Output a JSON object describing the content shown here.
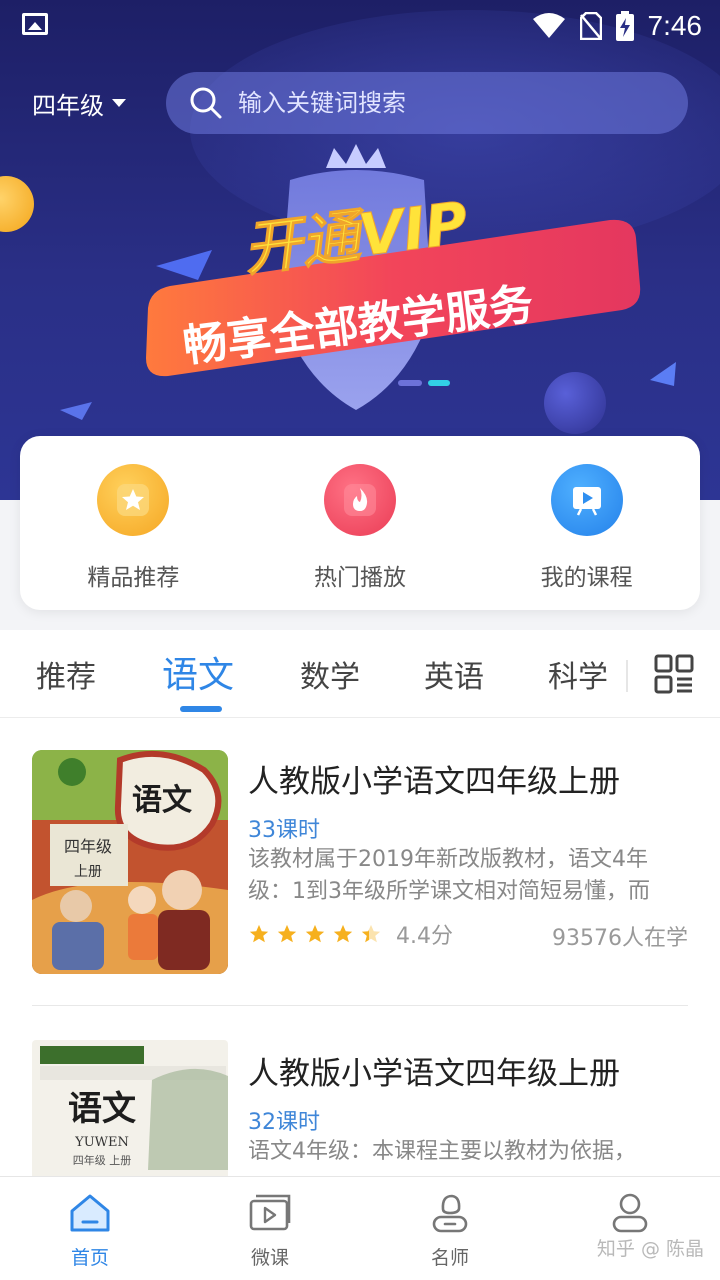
{
  "status_bar": {
    "time": "7:46"
  },
  "header": {
    "grade_label": "四年级",
    "search_placeholder": "输入关键词搜索"
  },
  "banner": {
    "line1": "开通VIP",
    "line2": "畅享全部教学服务"
  },
  "quick_actions": [
    {
      "label": "精品推荐",
      "icon": "star-icon",
      "color": "#f7b429"
    },
    {
      "label": "热门播放",
      "icon": "flame-icon",
      "color": "#f04a5c"
    },
    {
      "label": "我的课程",
      "icon": "play-board-icon",
      "color": "#2f8ff0"
    }
  ],
  "tabs": [
    {
      "label": "推荐",
      "active": false
    },
    {
      "label": "语文",
      "active": true
    },
    {
      "label": "数学",
      "active": false
    },
    {
      "label": "英语",
      "active": false
    },
    {
      "label": "科学",
      "active": false
    }
  ],
  "courses": [
    {
      "title": "人教版小学语文四年级上册",
      "lessons": "33课时",
      "description": "该教材属于2019年新改版教材，语文4年级：1到3年级所学课文相对简短易懂，而",
      "rating": 4.4,
      "rating_text": "4.4分",
      "learners": "93576人在学",
      "cover": {
        "title": "语文",
        "grade": "四年级",
        "volume": "上册"
      }
    },
    {
      "title": "人教版小学语文四年级上册",
      "lessons": "32课时",
      "description": "语文4年级：本课程主要以教材为依据，",
      "cover": {
        "title": "语文",
        "grade": "四年级 上册",
        "subtitle": "YUWEN"
      }
    }
  ],
  "bottom_nav": [
    {
      "label": "首页",
      "icon": "home-icon",
      "active": true
    },
    {
      "label": "微课",
      "icon": "video-icon",
      "active": false
    },
    {
      "label": "名师",
      "icon": "teacher-icon",
      "active": false
    },
    {
      "label": "",
      "icon": "profile-icon",
      "active": false
    }
  ],
  "watermark": "知乎 @ 陈晶",
  "colors": {
    "accent": "#2f86e6",
    "hero_bg": "#232874",
    "vip_yellow": "#ffe33a",
    "vip_red": "#ee3f57"
  }
}
